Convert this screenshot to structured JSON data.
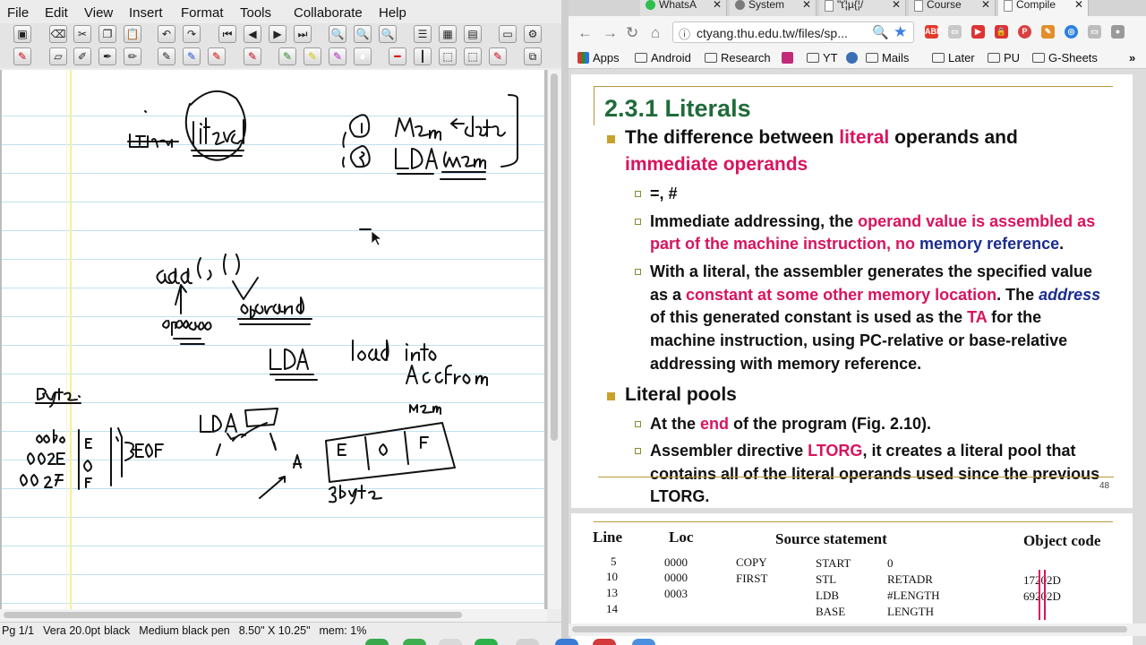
{
  "xournal": {
    "menu": [
      "File",
      "Edit",
      "View",
      "Insert",
      "Format",
      "Tools",
      "Collaborate",
      "Help"
    ],
    "status": {
      "page": "Pg 1/1",
      "font": "Vera 20.0pt",
      "color": "black",
      "pen": "Medium black pen",
      "size": "8.50\" X 10.25\"",
      "mem": "mem: 1%"
    }
  },
  "browser": {
    "tabs": [
      {
        "label": "WhatsA",
        "icon_color": "#2fbf4d",
        "icon": "whatsapp-icon"
      },
      {
        "label": "System",
        "icon_color": "#7b7b7b",
        "icon": "gear-icon"
      },
      {
        "label": "\"ť¦µ{¦/",
        "icon_color": "#ffffff",
        "icon": "document-icon"
      },
      {
        "label": "Course",
        "icon_color": "#ffffff",
        "icon": "document-icon"
      },
      {
        "label": "Compile",
        "icon_color": "#ffffff",
        "icon": "document-icon"
      }
    ],
    "url": "ctyang.thu.edu.tw/files/sp...",
    "bookmarks": [
      "Apps",
      "Android",
      "Research",
      "YT",
      "Mails",
      "Later",
      "PU",
      "G-Sheets"
    ],
    "more_bookmarks": "»"
  },
  "slide": {
    "title": "2.3.1  Literals",
    "number": "48",
    "b1_text": "The difference between ",
    "b1_hl1": "literal",
    "b1_text2": " operands and",
    "b1_hl2": "immediate operands",
    "s1": "=, #",
    "s2_t1": "Immediate addressing, the ",
    "s2_hl1": "operand value is assembled as",
    "s2_hl2": "part of the machine instruction, no ",
    "s2_bl": "memory reference",
    "s2_t2": ".",
    "s3_l1": "With a literal, the assembler generates the specified value",
    "s3_t1": "as a ",
    "s3_hl": "constant at some other memory location",
    "s3_t2": ". The ",
    "s3_it": "address",
    "s3_l3a": "of this generated constant is used as the ",
    "s3_l3hl": "TA",
    "s3_l3b": " for the",
    "s3_l4": "machine instruction, using PC-relative or base-relative",
    "s3_l5": "addressing with memory reference.",
    "b2": "Literal pools",
    "s4_t1": "At the ",
    "s4_hl": "end",
    "s4_t2": " of the program (Fig. 2.10).",
    "s5_t1": "Assembler directive ",
    "s5_hl": "LTORG",
    "s5_t2": ", it creates a literal pool that",
    "s5_l2": "contains all of the literal operands used since the previous",
    "s5_l3": "LTORG."
  },
  "table": {
    "headers": {
      "line": "Line",
      "loc": "Loc",
      "source": "Source statement",
      "obj": "Object code"
    },
    "rows": [
      {
        "line": "5",
        "loc": "0000",
        "label": "COPY",
        "op": "START",
        "operand": "0",
        "obj": ""
      },
      {
        "line": "10",
        "loc": "0000",
        "label": "FIRST",
        "op": "STL",
        "operand": "RETADR",
        "obj": "17202D"
      },
      {
        "line": "13",
        "loc": "0003",
        "label": "",
        "op": "LDB",
        "operand": "#LENGTH",
        "obj": "69202D"
      },
      {
        "line": "14",
        "loc": "",
        "label": "",
        "op": "BASE",
        "operand": "LENGTH",
        "obj": ""
      }
    ]
  }
}
